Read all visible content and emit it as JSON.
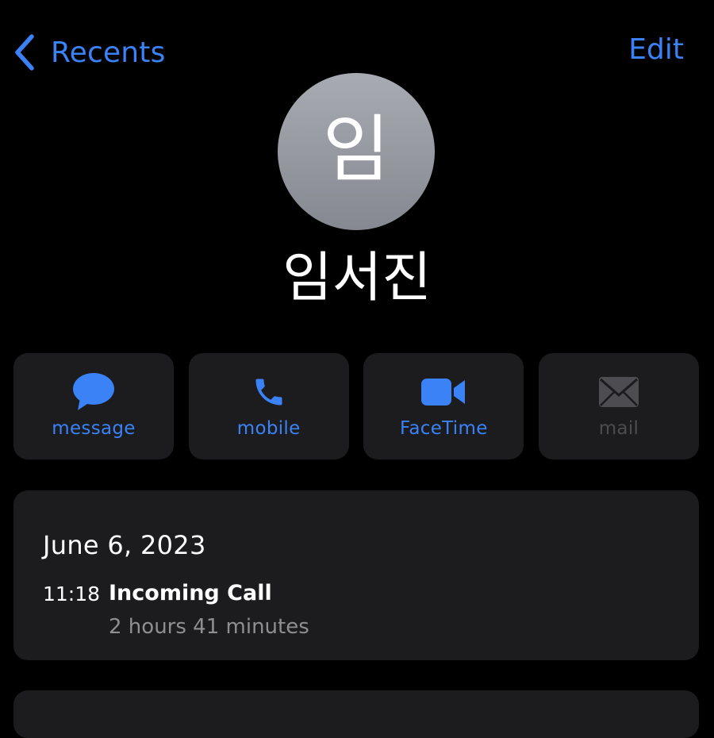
{
  "nav": {
    "back_label": "Recents",
    "edit_label": "Edit"
  },
  "contact": {
    "initial": "임",
    "name": "임서진"
  },
  "actions": [
    {
      "label": "message",
      "icon": "message-bubble-icon",
      "enabled": true
    },
    {
      "label": "mobile",
      "icon": "phone-icon",
      "enabled": true
    },
    {
      "label": "FaceTime",
      "icon": "video-camera-icon",
      "enabled": true
    },
    {
      "label": "mail",
      "icon": "envelope-icon",
      "enabled": false
    }
  ],
  "call_history": {
    "date": "June 6, 2023",
    "entries": [
      {
        "time": "11:18",
        "type": "Incoming Call",
        "duration": "2 hours 41 minutes"
      }
    ]
  },
  "colors": {
    "accent": "#3b82f6",
    "card": "#1c1c1e",
    "disabled": "#4d4d51",
    "secondary_text": "#8e8e93"
  }
}
